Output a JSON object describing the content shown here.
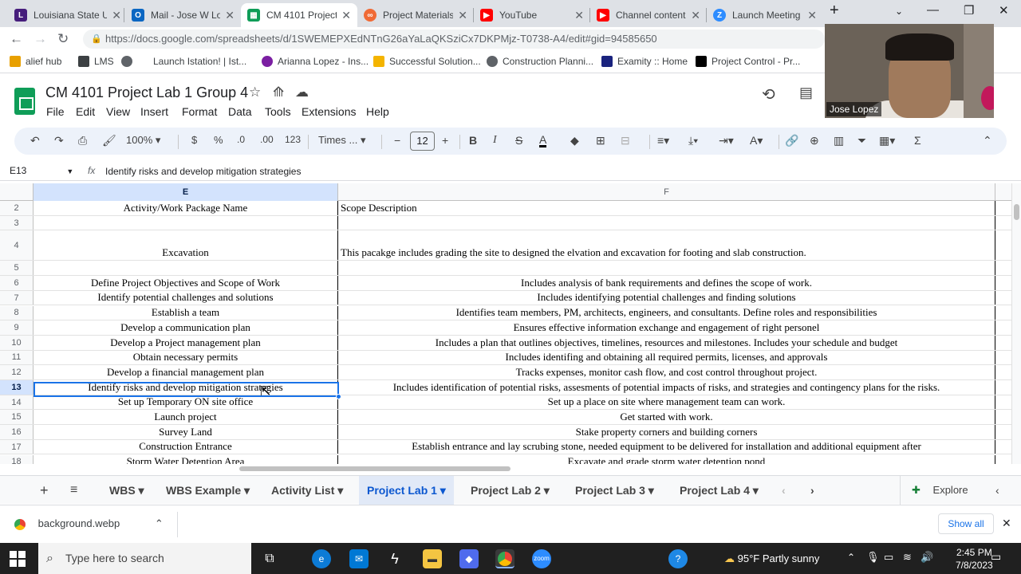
{
  "browser": {
    "tabs": [
      {
        "label": "Louisiana State U",
        "color": "#461d7c",
        "icon": "lsu-icon"
      },
      {
        "label": "Mail - Jose W Lop",
        "color": "#0a66c2",
        "icon": "outlook-icon"
      },
      {
        "label": "CM 4101 Project",
        "color": "#0f9d58",
        "icon": "sheets-icon"
      },
      {
        "label": "Project Materials",
        "color": "#f06a35",
        "icon": "asana-icon"
      },
      {
        "label": "YouTube",
        "color": "#ff0000",
        "icon": "youtube-icon"
      },
      {
        "label": "Channel content",
        "color": "#ff0000",
        "icon": "youtube-studio-icon"
      },
      {
        "label": "Launch Meeting",
        "color": "#2d8cff",
        "icon": "zoom-icon"
      }
    ],
    "active_tab": 2,
    "url": "https://docs.google.com/spreadsheets/d/1SWEMEPXEdNTnG26aYaLaQKSziCx7DKPMjz-T0738-A4/edit#gid=94585650",
    "bookmarks": [
      {
        "label": "alief hub",
        "color": "#e8a000"
      },
      {
        "label": "LMS",
        "color": "#3c4043"
      },
      {
        "label": "Launch Istation! | Ist...",
        "color": "#5f6368"
      },
      {
        "label": "Arianna Lopez - Ins...",
        "color": "#7b1fa2"
      },
      {
        "label": "Successful Solution...",
        "color": "#f4b400"
      },
      {
        "label": "Construction Planni...",
        "color": "#5f6368"
      },
      {
        "label": "Examity :: Home",
        "color": "#1a237e"
      },
      {
        "label": "Project Control - Pr...",
        "color": "#000000"
      }
    ]
  },
  "sheets": {
    "title": "CM 4101 Project Lab 1 Group 4",
    "menu": [
      "File",
      "Edit",
      "View",
      "Insert",
      "Format",
      "Data",
      "Tools",
      "Extensions",
      "Help"
    ],
    "toolbar": {
      "zoom": "100%",
      "currency": "$",
      "percent": "%",
      "dec_decrease": ".0",
      "dec_increase": ".00",
      "more_formats": "123",
      "font": "Times ...",
      "font_size": "12"
    },
    "name_box": "E13",
    "fx_label": "fx",
    "formula": "Identify risks and develop mitigation strategies",
    "columns": [
      "E",
      "F"
    ],
    "rows": [
      {
        "n": "2",
        "e": "Activity/Work Package Name",
        "f": "Scope Description",
        "f_align": "left"
      },
      {
        "n": "3",
        "e": "",
        "f": ""
      },
      {
        "n": "4",
        "e": "Excavation",
        "f": "This pacakge includes grading the site to designed the elvation and excavation for footing and slab construction.",
        "f_align": "left"
      },
      {
        "n": "5",
        "e": "",
        "f": ""
      },
      {
        "n": "6",
        "e": "Define Project Objectives and Scope of Work",
        "f": "Includes analysis of bank requirements and defines the scope of work."
      },
      {
        "n": "7",
        "e": "Identify potential challenges and solutions",
        "f": "Includes identifying potential challenges and finding solutions"
      },
      {
        "n": "8",
        "e": "Establish a team",
        "f": "Identifies team members, PM, architects, engineers, and consultants. Define roles and responsibilities"
      },
      {
        "n": "9",
        "e": "Develop a communication plan",
        "f": "Ensures effective information exchange and engagement of right personel"
      },
      {
        "n": "10",
        "e": "Develop a Project management plan",
        "f": "Includes a plan that outlines objectives, timelines, resources and milestones. Includes your schedule and budget"
      },
      {
        "n": "11",
        "e": "Obtain necessary permits",
        "f": "Includes identifing and obtaining all required permits, licenses, and approvals"
      },
      {
        "n": "12",
        "e": "Develop a financial management plan",
        "f": "Tracks expenses, monitor cash flow, and cost control throughout project."
      },
      {
        "n": "13",
        "e": "Identify risks and develop mitigation strategies",
        "f": "Includes identification of potential risks, assesments of potential impacts of risks, and strategies and contingency plans for the risks."
      },
      {
        "n": "14",
        "e": "Set up Temporary ON site office",
        "f": "Set up a place on site where management team can work."
      },
      {
        "n": "15",
        "e": "Launch project",
        "f": "Get started with work."
      },
      {
        "n": "16",
        "e": "Survey Land",
        "f": "Stake property corners and building corners"
      },
      {
        "n": "17",
        "e": "Construction Entrance",
        "f": "Establish entrance and lay scrubing stone, needed equipment to be delivered for installation and additional equipment after"
      },
      {
        "n": "18",
        "e": "Storm Water Detention Area",
        "f": "Excavate and grade storm water detention pond"
      }
    ],
    "selected_row": "13",
    "sheet_tabs": [
      "WBS",
      "WBS Example",
      "Activity List",
      "Project Lab 1",
      "Project Lab 2",
      "Project Lab 3",
      "Project Lab 4"
    ],
    "active_sheet": "Project Lab 1",
    "explore": "Explore"
  },
  "download": {
    "file": "background.webp",
    "show_all": "Show all"
  },
  "webcam": {
    "name": "Jose Lopez"
  },
  "taskbar": {
    "search_placeholder": "Type here to search",
    "weather": "95°F  Partly sunny",
    "time": "2:45 PM",
    "date": "7/8/2023"
  }
}
